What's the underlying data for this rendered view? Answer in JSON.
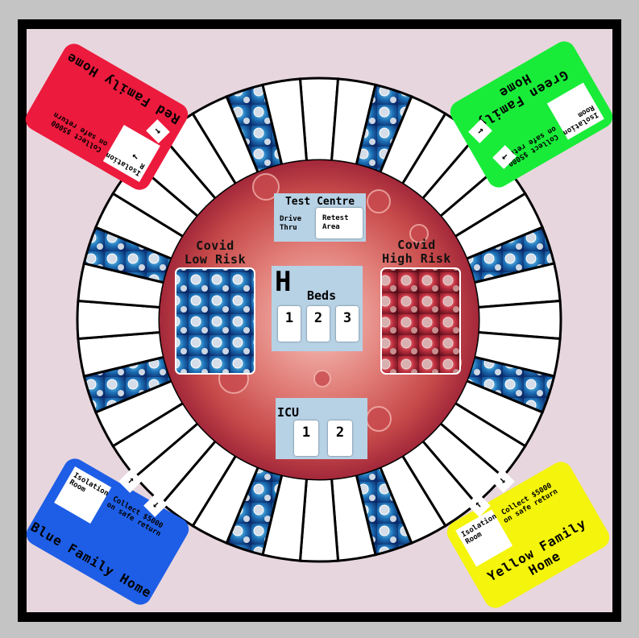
{
  "colors": {
    "background": "#c4c4c4",
    "frame": "#000000",
    "felt": "#e8d6de",
    "panel": "#b7d1e5",
    "red_home": "#ec1a3c",
    "green_home": "#18ec38",
    "blue_home": "#1e5ee6",
    "yellow_home": "#f4f40c",
    "high_risk": "#b8283a",
    "low_risk": "#1e6ab0"
  },
  "center": {
    "test_centre": {
      "title": "Test Centre",
      "drive_thru": "Drive\nThru",
      "retest_area": "Retest\nArea"
    },
    "low_risk": "Covid\nLow Risk",
    "high_risk": "Covid\nHigh Risk",
    "hospital": {
      "letter": "H",
      "title": "Beds",
      "beds": [
        "1",
        "2",
        "3"
      ]
    },
    "icu": {
      "title": "ICU",
      "beds": [
        "1",
        "2"
      ]
    }
  },
  "homes": [
    {
      "id": "red",
      "title": "Red Family Home",
      "collect": "Collect $5000\non safe return",
      "isolation": "Isolation\nRoom"
    },
    {
      "id": "green",
      "title": "Green Family Home",
      "collect": "Collect $5000\non safe return",
      "isolation": "Isolation\nRoom"
    },
    {
      "id": "blue",
      "title": "Blue Family Home",
      "collect": "Collect $5000\non safe return",
      "isolation": "Isolation\nRoom"
    },
    {
      "id": "yellow",
      "title": "Yellow Family Home",
      "collect": "Collect $5000\non safe return",
      "isolation": "Isolation\nRoom"
    }
  ],
  "track": {
    "squares": 40,
    "virus_squares": [
      2,
      8,
      12,
      18,
      22,
      28,
      32,
      38
    ]
  },
  "arrows": {
    "in": "↑",
    "out": "↓"
  }
}
